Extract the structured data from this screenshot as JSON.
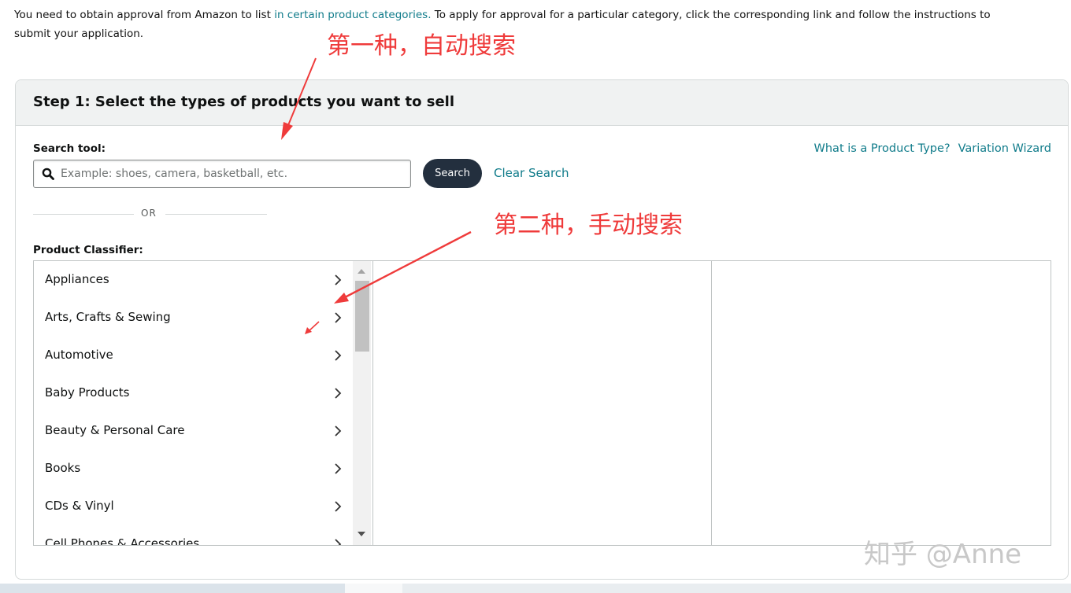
{
  "intro": {
    "text_before": "You need to obtain approval from Amazon to list ",
    "link": "in certain product categories.",
    "text_after": " To apply for approval for a particular category, click the corresponding link and follow the instructions to submit your application."
  },
  "step1": {
    "title": "Step 1: Select the types of products you want to sell",
    "search_label": "Search tool:",
    "search_placeholder": "Example: shoes, camera, basketball, etc.",
    "search_value": "",
    "search_button": "Search",
    "clear_search": "Clear Search",
    "or_text": "OR",
    "what_is_link": "What is a Product Type?",
    "variation_link": "Variation Wizard",
    "classifier_label": "Product Classifier:",
    "categories": [
      "Appliances",
      "Arts, Crafts & Sewing",
      "Automotive",
      "Baby Products",
      "Beauty & Personal Care",
      "Books",
      "CDs & Vinyl",
      "Cell Phones & Accessories"
    ]
  },
  "annotations": {
    "first": "第一种，自动搜索",
    "second": "第二种，手动搜索",
    "color": "#ef3b3b"
  },
  "watermark": "知乎 @Anne",
  "colors": {
    "link": "#0f7b8a",
    "button_dark": "#232f3e",
    "header_bg": "#f0f2f2"
  },
  "icons": {
    "search": "magnifier-icon",
    "chevron": "chevron-right-icon"
  }
}
